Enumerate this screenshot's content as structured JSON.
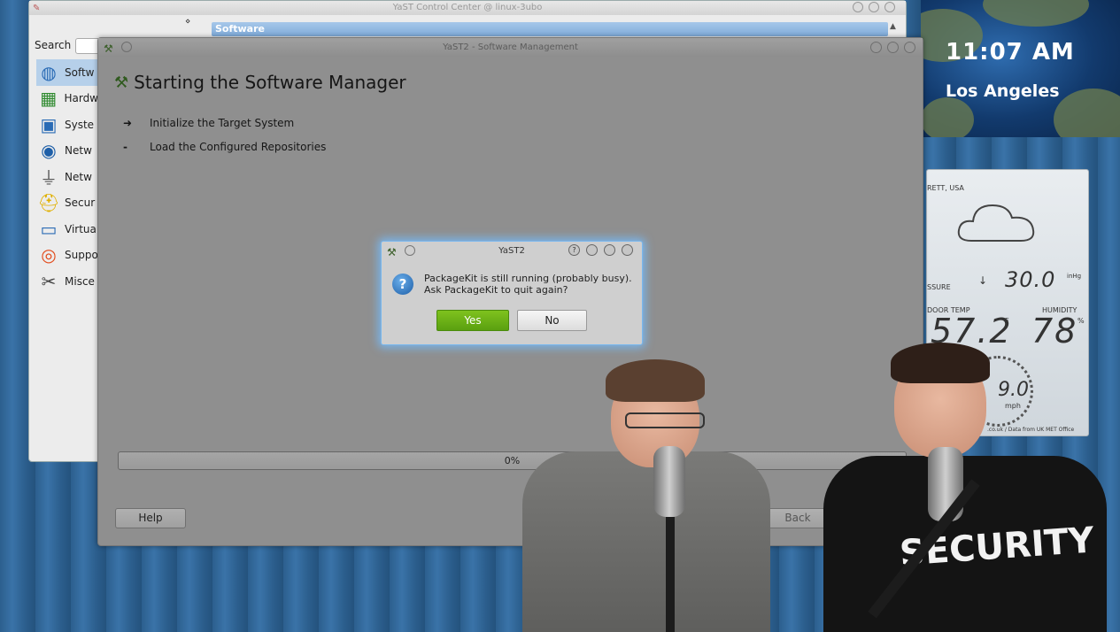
{
  "colors": {
    "accent_green": "#5aa010",
    "selection_blue": "#7eaad8",
    "dialog_glow": "#7ab8ee"
  },
  "clock_widget": {
    "time": "11:07 AM",
    "city": "Los Angeles"
  },
  "weather_widget": {
    "location": "RETT, USA",
    "icon": "cloud-icon",
    "pressure_label": "SSURE",
    "pressure_value": "30.0",
    "pressure_unit": "inHg",
    "outdoor_temp_label": "DOOR TEMP",
    "outdoor_temp": "57.2",
    "outdoor_temp_unit": "°F",
    "humidity_label": "HUMIDITY",
    "humidity": "78",
    "humidity_unit": "%",
    "wind_speed": "9.0",
    "wind_unit": "mph",
    "credit": ".co.uk / Data from UK MET Office"
  },
  "control_center": {
    "title": "YaST Control Center @ linux-3ubo",
    "search_label": "Search",
    "selected_category": "Software",
    "sidebar": [
      {
        "label": "Softw",
        "icon": "software-icon",
        "selected": true
      },
      {
        "label": "Hardw",
        "icon": "hardware-icon"
      },
      {
        "label": "Syste",
        "icon": "system-icon"
      },
      {
        "label": "Netw",
        "icon": "network-services-icon"
      },
      {
        "label": "Netw",
        "icon": "network-devices-icon"
      },
      {
        "label": "Secur",
        "icon": "security-icon"
      },
      {
        "label": "Virtua",
        "icon": "virtualization-icon"
      },
      {
        "label": "Suppo",
        "icon": "support-icon"
      },
      {
        "label": "Misce",
        "icon": "miscellaneous-icon"
      }
    ]
  },
  "software_manager": {
    "title": "YaST2 - Software Management",
    "heading": "Starting the Software Manager",
    "steps": [
      {
        "mark": "➜",
        "label": "Initialize the Target System"
      },
      {
        "mark": "-",
        "label": "Load the Configured Repositories"
      }
    ],
    "progress": "0%",
    "help_label": "Help",
    "back_label": "Back"
  },
  "dialog": {
    "title": "YaST2",
    "message_line1": "PackageKit is still running (probably busy).",
    "message_line2": "Ask PackageKit to quit again?",
    "yes_label": "Yes",
    "no_label": "No",
    "help_glyph": "?"
  },
  "video": {
    "shirt_text": "SECURITY"
  }
}
